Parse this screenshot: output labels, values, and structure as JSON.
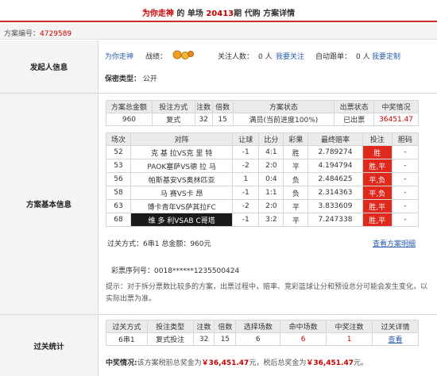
{
  "title": {
    "part1": "为你走神",
    "part2": " 的 单场 ",
    "issue": "20413",
    "part3": "期 代购 方案详情"
  },
  "plan_no": {
    "label": "方案编号：",
    "value": "4729589"
  },
  "sections": {
    "initiator": "发起人信息",
    "basic": "方案基本信息",
    "pass_stats": "过关统计"
  },
  "initiator": {
    "name": "为你走神",
    "record_label": "战绩：",
    "follow_label": "关注人数：",
    "follow_count": "0 人",
    "follow_link": "我要关注",
    "auto_label": "自动跟单：",
    "auto_count": "0 人",
    "auto_link": "我要定制",
    "privacy_label": "保密类型：",
    "privacy_value": "公开"
  },
  "summary_table": {
    "headers": [
      "方案总金额",
      "投注方式",
      "注数",
      "倍数",
      "方案状态",
      "出票状态",
      "中奖情况"
    ],
    "row": [
      "960",
      "复式",
      "32",
      "15",
      "满员(当前进度100%)",
      "已出票",
      "36451.47"
    ]
  },
  "match_table": {
    "headers": [
      "场次",
      "对阵",
      "让球",
      "比分",
      "彩果",
      "最终赔率",
      "投注",
      "胆码"
    ],
    "rows": [
      {
        "no": "52",
        "match": "克 基 拉VS克 里 特",
        "handicap": "-1",
        "score": "4:1",
        "result": "胜",
        "odds": "2.789274",
        "bet": "胜",
        "banker": "-"
      },
      {
        "no": "53",
        "match": "PAOK塞萨VS德 拉 马",
        "handicap": "-2",
        "score": "2:0",
        "result": "平",
        "odds": "4.194794",
        "bet": "胜,平",
        "banker": "-"
      },
      {
        "no": "56",
        "match": "帕斯基安VS奥林匹亚",
        "handicap": "1",
        "score": "0:4",
        "result": "负",
        "odds": "2.484625",
        "bet": "平,负",
        "banker": "-"
      },
      {
        "no": "58",
        "match": "马 赛VS卡 昂",
        "handicap": "-1",
        "score": "1:1",
        "result": "负",
        "odds": "2.314363",
        "bet": "平,负",
        "banker": "-"
      },
      {
        "no": "63",
        "match": "博卡青年VS萨其拉FC",
        "handicap": "-2",
        "score": "2:0",
        "result": "平",
        "odds": "3.833609",
        "bet": "胜,平",
        "banker": "-"
      },
      {
        "no": "68",
        "match": "维 多 利VSAB C哥塔",
        "handicap": "-1",
        "score": "3:2",
        "result": "平",
        "odds": "7.247338",
        "bet": "胜,平",
        "banker": "-"
      }
    ]
  },
  "pass_summary": {
    "text": "过关方式：6串1 总金额：960元",
    "link": "查看方案明细"
  },
  "serial": {
    "label": "彩票序列号：",
    "value": "0018******1235500424"
  },
  "tip": "提示：对于拆分票数比较多的方案，出票过程中，赔率、竞彩篮球让分和预设总分可能会发生变化，以实际出票为准。",
  "pass_table": {
    "headers": [
      "过关方式",
      "投注类型",
      "注数",
      "倍数",
      "选择场数",
      "命中场数",
      "中奖注数",
      "过关详情"
    ],
    "row": [
      "6串1",
      "复式投注",
      "32",
      "15",
      "6",
      "6",
      "1",
      "查看"
    ]
  },
  "prize": {
    "label": "中奖情况:",
    "text1": "该方案税前总奖金为",
    "pre_tax": "￥36,451.47",
    "text2": "元，税后总奖金为",
    "post_tax": "￥36,451.47",
    "text3": "元。"
  },
  "colors": {
    "accent_red": "#c00",
    "result_cell": "#e0281c",
    "link_blue": "#2a5db0"
  }
}
